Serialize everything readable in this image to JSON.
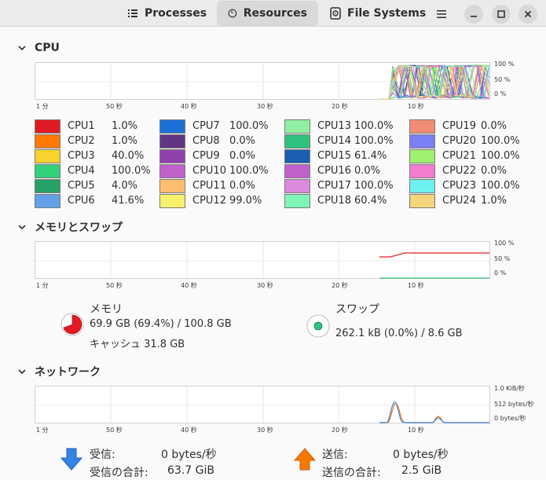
{
  "tabs": {
    "processes": "Processes",
    "resources": "Resources",
    "filesystems": "File Systems"
  },
  "cpu": {
    "title": "CPU",
    "y_labels": [
      "100 %",
      "50 %",
      "0 %"
    ],
    "x_labels": [
      "1 分",
      "50 秒",
      "40 秒",
      "30 秒",
      "20 秒",
      "10 秒"
    ],
    "cores": [
      {
        "name": "CPU1",
        "value": "1.0%",
        "color": "#e01b24"
      },
      {
        "name": "CPU2",
        "value": "1.0%",
        "color": "#ff7800"
      },
      {
        "name": "CPU3",
        "value": "40.0%",
        "color": "#f6d32d"
      },
      {
        "name": "CPU4",
        "value": "100.0%",
        "color": "#33d17a"
      },
      {
        "name": "CPU5",
        "value": "4.0%",
        "color": "#26a269"
      },
      {
        "name": "CPU6",
        "value": "41.6%",
        "color": "#62a0ea"
      },
      {
        "name": "CPU7",
        "value": "100.0%",
        "color": "#1c71d8"
      },
      {
        "name": "CPU8",
        "value": "0.0%",
        "color": "#613583"
      },
      {
        "name": "CPU9",
        "value": "0.0%",
        "color": "#9141ac"
      },
      {
        "name": "CPU10",
        "value": "100.0%",
        "color": "#c061cb"
      },
      {
        "name": "CPU11",
        "value": "0.0%",
        "color": "#ffbe6f"
      },
      {
        "name": "CPU12",
        "value": "99.0%",
        "color": "#f9f06b"
      },
      {
        "name": "CPU13",
        "value": "100.0%",
        "color": "#8ff0a4"
      },
      {
        "name": "CPU14",
        "value": "100.0%",
        "color": "#2ec27e"
      },
      {
        "name": "CPU15",
        "value": "61.4%",
        "color": "#1a5fb4"
      },
      {
        "name": "CPU16",
        "value": "0.0%",
        "color": "#c061cb"
      },
      {
        "name": "CPU17",
        "value": "100.0%",
        "color": "#dc8add"
      },
      {
        "name": "CPU18",
        "value": "60.4%",
        "color": "#7ff5b8"
      },
      {
        "name": "CPU19",
        "value": "0.0%",
        "color": "#f28c74"
      },
      {
        "name": "CPU20",
        "value": "100.0%",
        "color": "#7b7ff5"
      },
      {
        "name": "CPU21",
        "value": "100.0%",
        "color": "#a0f070"
      },
      {
        "name": "CPU22",
        "value": "0.0%",
        "color": "#f37bd0"
      },
      {
        "name": "CPU23",
        "value": "100.0%",
        "color": "#6ff0f0"
      },
      {
        "name": "CPU24",
        "value": "1.0%",
        "color": "#f5d47a"
      }
    ]
  },
  "memory": {
    "title": "メモリとスワップ",
    "y_labels": [
      "100 %",
      "50 %",
      "0 %"
    ],
    "x_labels": [
      "1 分",
      "50 秒",
      "40 秒",
      "30 秒",
      "20 秒",
      "10 秒"
    ],
    "mem_label": "メモリ",
    "mem_usage": "69.9 GB (69.4%) / 100.8 GB",
    "cache": "キャッシュ 31.8 GB",
    "mem_percent": 69.4,
    "mem_color": "#e01b24",
    "swap_label": "スワップ",
    "swap_usage": "262.1 kB (0.0%) / 8.6 GB",
    "swap_color": "#2ec27e"
  },
  "network": {
    "title": "ネットワーク",
    "y_labels": [
      "1.0 KiB/秒",
      "512 bytes/秒",
      "0 bytes/秒"
    ],
    "x_labels": [
      "1 分",
      "50 秒",
      "40 秒",
      "30 秒",
      "20 秒",
      "10 秒"
    ],
    "recv_label": "受信:",
    "recv_value": "0 bytes/秒",
    "recv_total_label": "受信の合計:",
    "recv_total": "63.7 GiB",
    "recv_color": "#3584e4",
    "send_label": "送信:",
    "send_value": "0 bytes/秒",
    "send_total_label": "送信の合計:",
    "send_total": "2.5 GiB",
    "send_color": "#f57900"
  }
}
